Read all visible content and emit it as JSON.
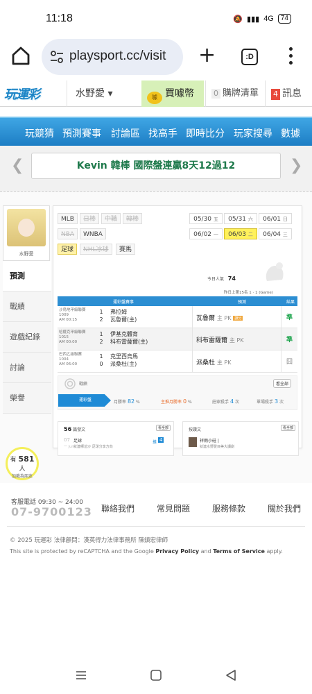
{
  "status": {
    "time": "11:18",
    "battery": "74",
    "network": "4G"
  },
  "browser": {
    "url": "playsport.cc/visit",
    "tab_count": ":D"
  },
  "header": {
    "logo": "玩運彩",
    "username": "水野愛 ▾",
    "buy_coins": "買噱幣",
    "coin_label": "噱",
    "cart_count": "0",
    "cart_label": "購牌清單",
    "msg_count": "4",
    "msg_label": "訊息"
  },
  "nav": [
    "玩競猜",
    "預測賽事",
    "討論區",
    "找高手",
    "即時比分",
    "玩家搜尋",
    "數據"
  ],
  "banner": {
    "text": "Kevin 韓棒 國際盤連贏8天12過12"
  },
  "sidebar": {
    "avatar_name": "水野愛",
    "items": [
      "預測",
      "戰績",
      "遊戲紀錄",
      "討論",
      "榮譽"
    ],
    "bulb_count": "581",
    "bulb_pre": "有",
    "bulb_unit": "人",
    "bulb_text": "加載為朋友"
  },
  "leagues": {
    "row1": [
      "MLB",
      "日棒",
      "中職",
      "韓棒"
    ],
    "row2": [
      "NBA",
      "WNBA"
    ],
    "row3": [
      "足球",
      "NHL冰球",
      "賽馬"
    ]
  },
  "dates": [
    {
      "md": "05/30",
      "wd": "五"
    },
    {
      "md": "05/31",
      "wd": "六"
    },
    {
      "md": "06/01",
      "wd": "日"
    },
    {
      "md": "06/02",
      "wd": "一"
    },
    {
      "md": "06/03",
      "wd": "二"
    },
    {
      "md": "06/04",
      "wd": "三"
    }
  ],
  "popularity": {
    "label": "今日人氣",
    "value": "74",
    "rank": "昨日上第15名 1 · 1 (Game)"
  },
  "table": {
    "headers": [
      "運彩盤賽事",
      "預測",
      "結果"
    ],
    "rows": [
      {
        "league": "沙烏地甲級聯賽",
        "code": "1009",
        "time": "AM 00:15",
        "score1": "1",
        "score2": "2",
        "team1": "弗拉姆",
        "team2": "瓦魯爾(主)",
        "pick": "瓦魯爾",
        "pk": "主 PK",
        "badge": "讓分",
        "result": "準"
      },
      {
        "league": "哈薩克甲級聯賽",
        "code": "1015",
        "time": "AM 00:00",
        "score1": "1",
        "score2": "2",
        "team1": "伊基克體育",
        "team2": "科布雷薩爾(主)",
        "pick": "科布雷薩爾",
        "pk": "主 PK",
        "badge": "",
        "result": "準"
      },
      {
        "league": "巴西乙級聯賽",
        "code": "1004",
        "time": "AM 06:00",
        "score1": "1",
        "score2": "0",
        "team1": "克里西烏馬",
        "team2": "派桑杜(主)",
        "pick": "派桑杜",
        "pk": "主 PK",
        "badge": "",
        "result": "囧"
      }
    ]
  },
  "stats": {
    "title": "戰績",
    "view_all": "看全部",
    "tag": "運彩盤",
    "items": [
      {
        "label": "月勝率",
        "value": "82",
        "unit": "%"
      },
      {
        "label": "主推月勝率",
        "value": "0",
        "unit": "%"
      },
      {
        "label": "莊家殺手",
        "value": "4",
        "unit": "次"
      },
      {
        "label": "單場殺手",
        "value": "3",
        "unit": "次"
      }
    ]
  },
  "mini_left": {
    "count": "56",
    "title": "篇發文",
    "view_all": "看全部",
    "date": "07",
    "month": "一 Jun",
    "line": "足球",
    "sub": "就連哪這沙 足球分享方向",
    "reply_label": "推",
    "reply_count": "4"
  },
  "mini_right": {
    "title": "按讚文",
    "view_all": "看全部",
    "line": "祥雨小硅 |",
    "sub": "就連水野愛目美大讀劇"
  },
  "footer": {
    "service_label": "客服電話 09:30 ~ 24:00",
    "phone": "07-9700123",
    "links": [
      "聯絡我們",
      "常見問題",
      "服務條款",
      "關於我們"
    ],
    "copyright": "© 2025 玩運彩 法律顧問：漢英得力法律事務所 陳鎮宏律師",
    "recaptcha_pre": "This site is protected by reCAPTCHA and the Google ",
    "privacy": "Privacy Policy",
    "and": " and ",
    "terms": "Terms of Service",
    "recaptcha_post": " apply."
  }
}
